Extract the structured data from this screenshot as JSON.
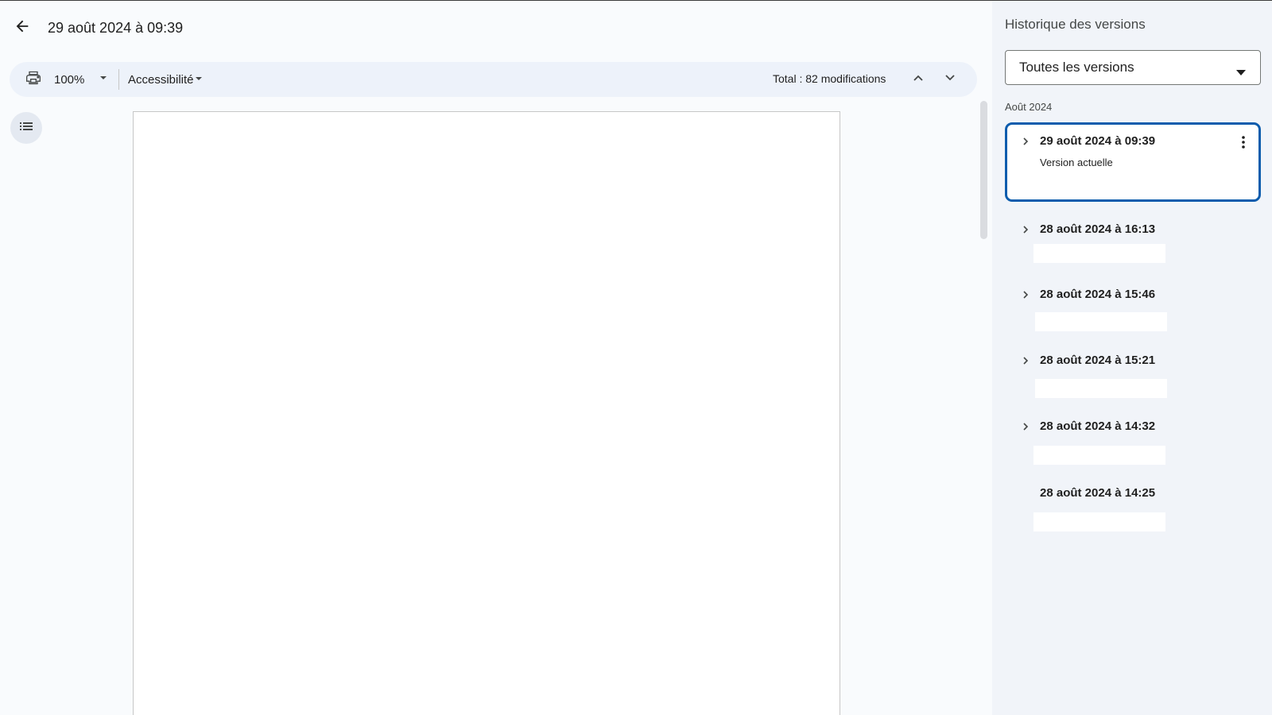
{
  "header": {
    "title": "29 août 2024 à 09:39"
  },
  "toolbar": {
    "zoom": "100%",
    "accessibility_label": "Accessibilité",
    "total_changes": "Total : 82 modifications"
  },
  "icons": {
    "back": "arrow-left-icon",
    "print": "print-icon",
    "zoom_dropdown": "caret-down-icon",
    "accessibility_dropdown": "caret-down-icon",
    "previous_change": "chevron-up-icon",
    "next_change": "chevron-down-icon",
    "outline": "list-icon",
    "more": "more-vert-icon",
    "expand": "chevron-right-icon"
  },
  "panel": {
    "title": "Historique des versions",
    "filter": "Toutes les versions",
    "month": "Août 2024",
    "versions": [
      {
        "date": "29 août 2024 à 09:39",
        "subtitle": "Version actuelle",
        "selected": true,
        "expandable": true
      },
      {
        "date": "28 août 2024 à 16:13",
        "subtitle": "",
        "selected": false,
        "expandable": true
      },
      {
        "date": "28 août 2024 à 15:46",
        "subtitle": "",
        "selected": false,
        "expandable": true
      },
      {
        "date": "28 août 2024 à 15:21",
        "subtitle": "",
        "selected": false,
        "expandable": true
      },
      {
        "date": "28 août 2024 à 14:32",
        "subtitle": "",
        "selected": false,
        "expandable": true
      },
      {
        "date": "28 août 2024 à 14:25",
        "subtitle": "",
        "selected": false,
        "expandable": false
      }
    ]
  },
  "colors": {
    "background": "#f9fbfd",
    "toolbar": "#edf2fa",
    "panel": "#f1f4f9",
    "selected_border": "#0b5cad"
  }
}
